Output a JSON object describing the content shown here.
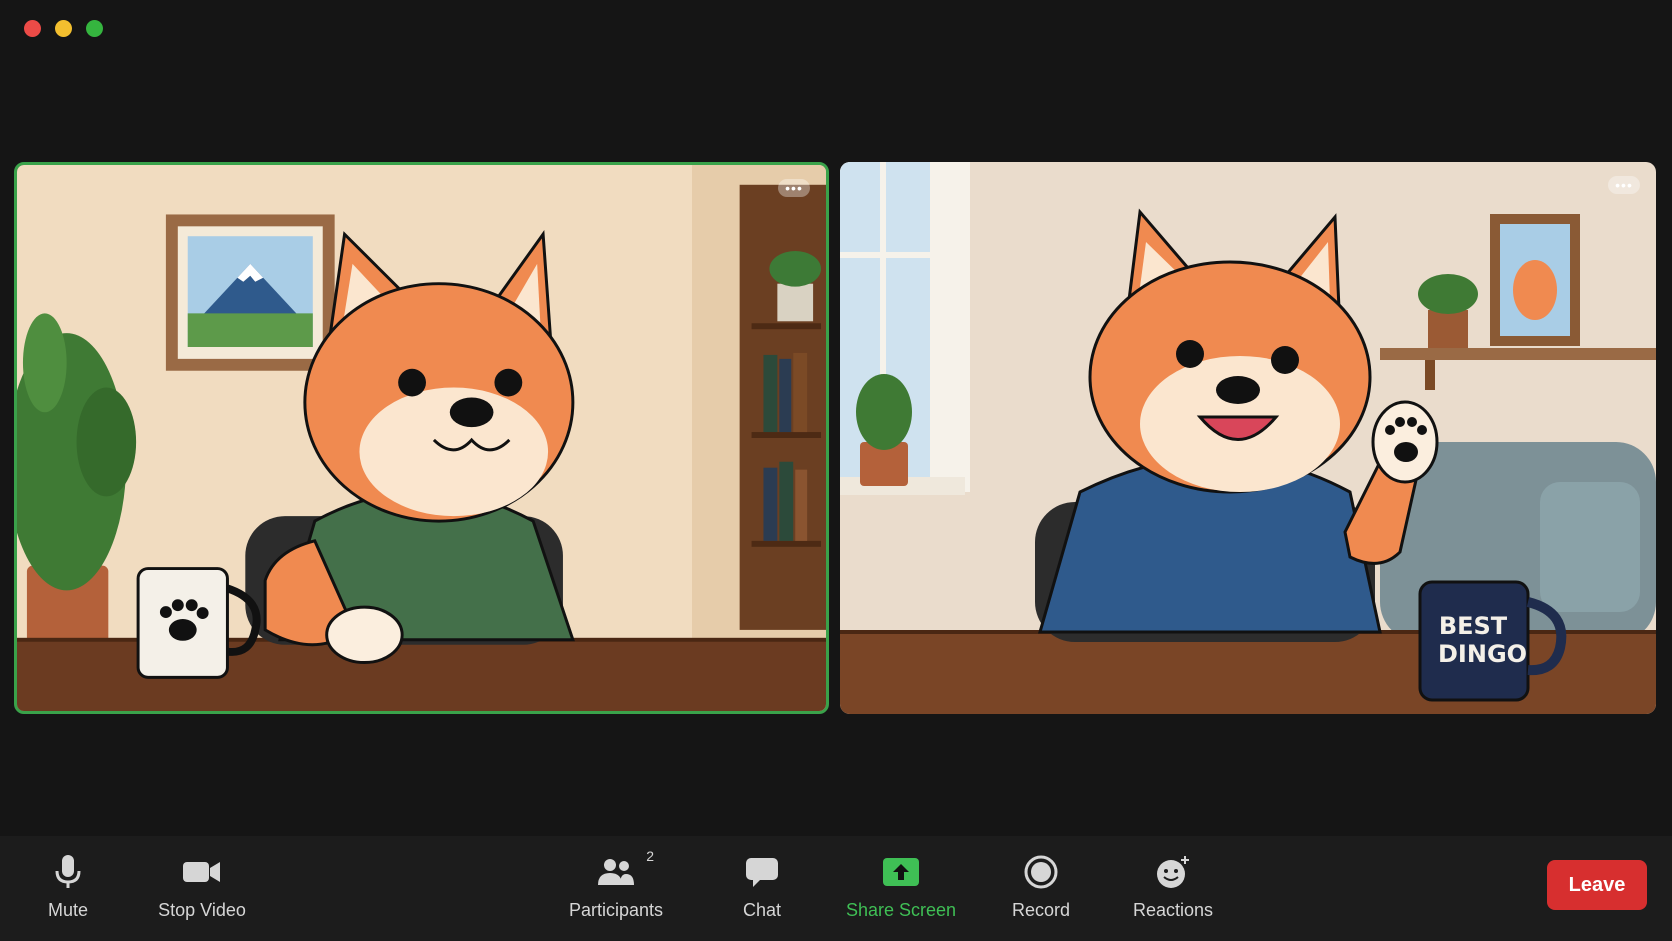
{
  "window": {
    "controls": [
      "close",
      "minimize",
      "maximize"
    ]
  },
  "tiles": {
    "left": {
      "more_label": "•••",
      "active_speaker": true,
      "mug_text": ""
    },
    "right": {
      "more_label": "•••",
      "mug_line1": "BEST",
      "mug_line2": "DINGO"
    }
  },
  "toolbar": {
    "mute_label": "Mute",
    "stop_video_label": "Stop Video",
    "participants_label": "Participants",
    "participants_count": "2",
    "chat_label": "Chat",
    "share_screen_label": "Share Screen",
    "record_label": "Record",
    "reactions_label": "Reactions",
    "leave_label": "Leave"
  },
  "colors": {
    "active_border": "#3aa24a",
    "share_green": "#3fbf55",
    "leave_red": "#d72f2f"
  }
}
